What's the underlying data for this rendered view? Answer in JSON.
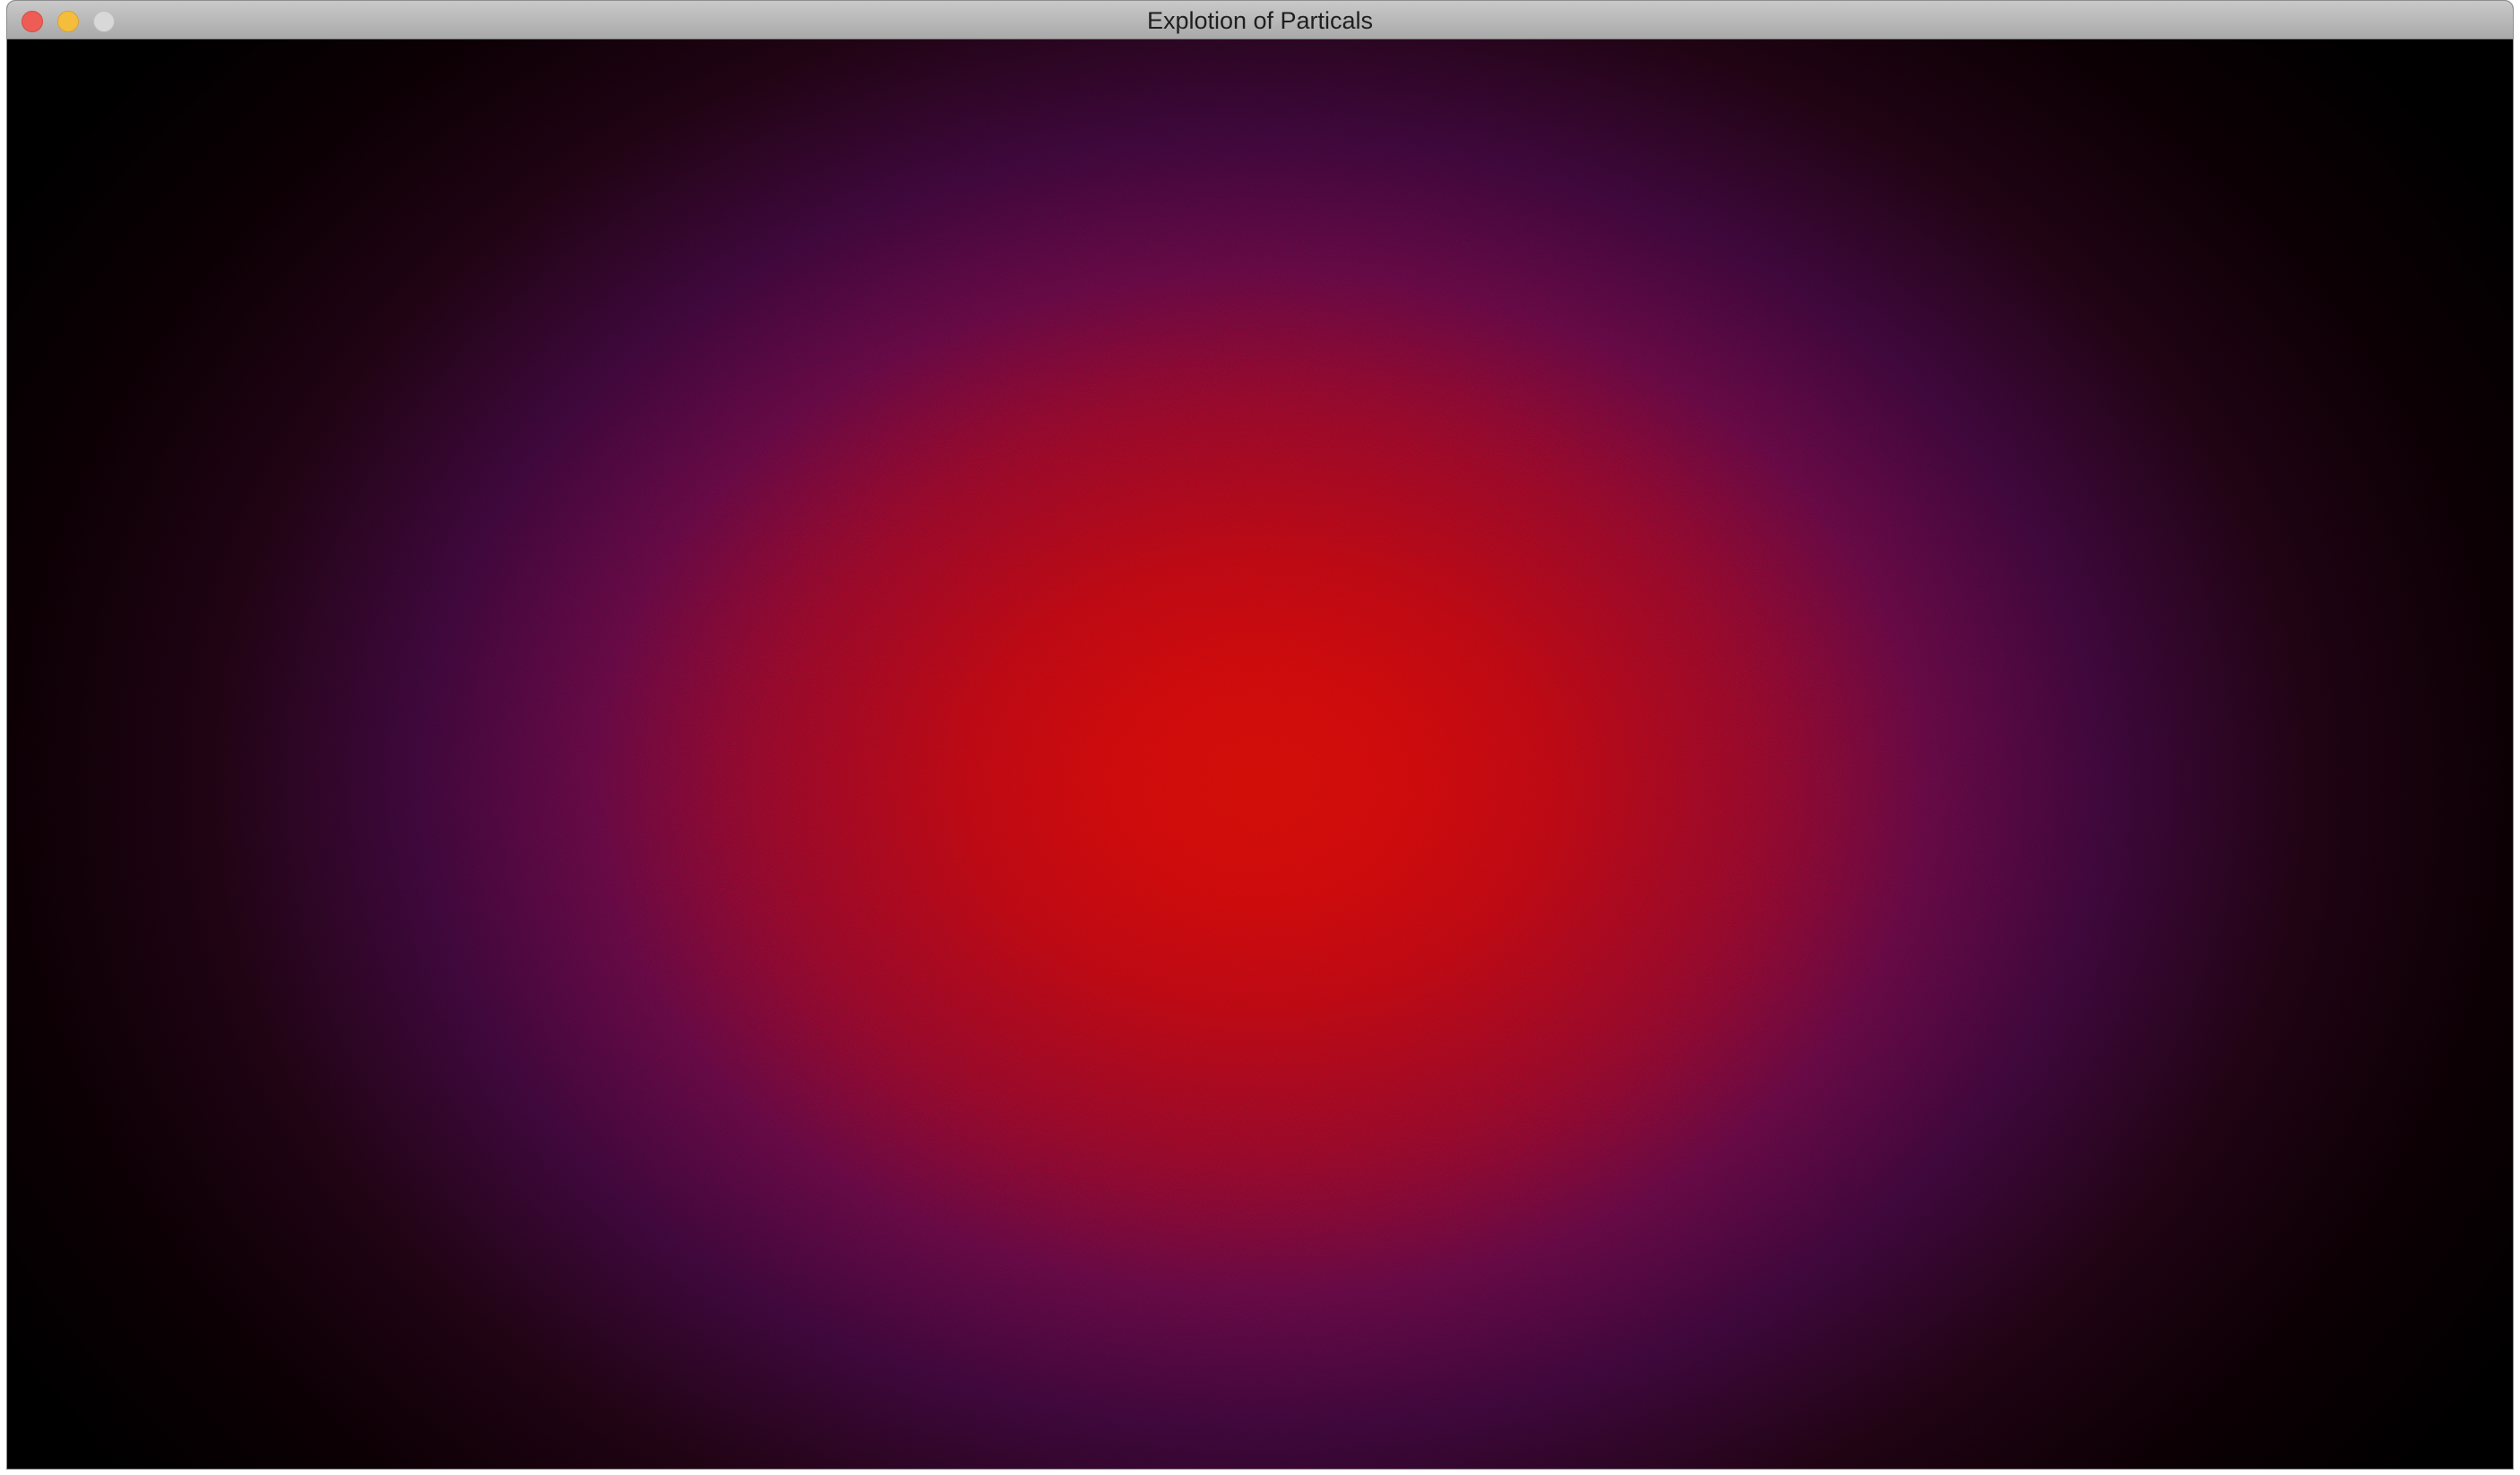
{
  "window": {
    "title": "Explotion of Particals"
  },
  "canvas": {
    "colors": {
      "core": "#cc1008",
      "mid": "#8e0a2a",
      "halo": "#38083c",
      "background": "#000000"
    }
  }
}
